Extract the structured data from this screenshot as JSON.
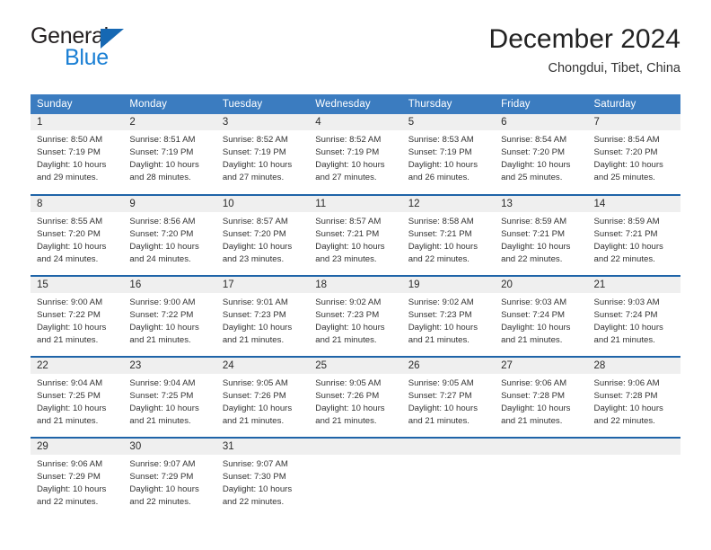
{
  "brand": {
    "name_part1": "General",
    "name_part2": "Blue",
    "triangle_icon": "triangle-icon",
    "accent_dark": "#231f20",
    "accent_blue": "#1a7fd4"
  },
  "header": {
    "title": "December 2024",
    "subtitle": "Chongdui, Tibet, China"
  },
  "theme": {
    "header_bg": "#3b7cc0",
    "row_divider": "#1f64a8",
    "daynum_bg": "#efefef"
  },
  "weekday_headers": [
    "Sunday",
    "Monday",
    "Tuesday",
    "Wednesday",
    "Thursday",
    "Friday",
    "Saturday"
  ],
  "labels": {
    "sunrise_prefix": "Sunrise:",
    "sunset_prefix": "Sunset:",
    "daylight_prefix": "Daylight:"
  },
  "weeks": [
    {
      "days": [
        {
          "num": "1",
          "sunrise": "Sunrise: 8:50 AM",
          "sunset": "Sunset: 7:19 PM",
          "daylight_l1": "Daylight: 10 hours",
          "daylight_l2": "and 29 minutes."
        },
        {
          "num": "2",
          "sunrise": "Sunrise: 8:51 AM",
          "sunset": "Sunset: 7:19 PM",
          "daylight_l1": "Daylight: 10 hours",
          "daylight_l2": "and 28 minutes."
        },
        {
          "num": "3",
          "sunrise": "Sunrise: 8:52 AM",
          "sunset": "Sunset: 7:19 PM",
          "daylight_l1": "Daylight: 10 hours",
          "daylight_l2": "and 27 minutes."
        },
        {
          "num": "4",
          "sunrise": "Sunrise: 8:52 AM",
          "sunset": "Sunset: 7:19 PM",
          "daylight_l1": "Daylight: 10 hours",
          "daylight_l2": "and 27 minutes."
        },
        {
          "num": "5",
          "sunrise": "Sunrise: 8:53 AM",
          "sunset": "Sunset: 7:19 PM",
          "daylight_l1": "Daylight: 10 hours",
          "daylight_l2": "and 26 minutes."
        },
        {
          "num": "6",
          "sunrise": "Sunrise: 8:54 AM",
          "sunset": "Sunset: 7:20 PM",
          "daylight_l1": "Daylight: 10 hours",
          "daylight_l2": "and 25 minutes."
        },
        {
          "num": "7",
          "sunrise": "Sunrise: 8:54 AM",
          "sunset": "Sunset: 7:20 PM",
          "daylight_l1": "Daylight: 10 hours",
          "daylight_l2": "and 25 minutes."
        }
      ]
    },
    {
      "days": [
        {
          "num": "8",
          "sunrise": "Sunrise: 8:55 AM",
          "sunset": "Sunset: 7:20 PM",
          "daylight_l1": "Daylight: 10 hours",
          "daylight_l2": "and 24 minutes."
        },
        {
          "num": "9",
          "sunrise": "Sunrise: 8:56 AM",
          "sunset": "Sunset: 7:20 PM",
          "daylight_l1": "Daylight: 10 hours",
          "daylight_l2": "and 24 minutes."
        },
        {
          "num": "10",
          "sunrise": "Sunrise: 8:57 AM",
          "sunset": "Sunset: 7:20 PM",
          "daylight_l1": "Daylight: 10 hours",
          "daylight_l2": "and 23 minutes."
        },
        {
          "num": "11",
          "sunrise": "Sunrise: 8:57 AM",
          "sunset": "Sunset: 7:21 PM",
          "daylight_l1": "Daylight: 10 hours",
          "daylight_l2": "and 23 minutes."
        },
        {
          "num": "12",
          "sunrise": "Sunrise: 8:58 AM",
          "sunset": "Sunset: 7:21 PM",
          "daylight_l1": "Daylight: 10 hours",
          "daylight_l2": "and 22 minutes."
        },
        {
          "num": "13",
          "sunrise": "Sunrise: 8:59 AM",
          "sunset": "Sunset: 7:21 PM",
          "daylight_l1": "Daylight: 10 hours",
          "daylight_l2": "and 22 minutes."
        },
        {
          "num": "14",
          "sunrise": "Sunrise: 8:59 AM",
          "sunset": "Sunset: 7:21 PM",
          "daylight_l1": "Daylight: 10 hours",
          "daylight_l2": "and 22 minutes."
        }
      ]
    },
    {
      "days": [
        {
          "num": "15",
          "sunrise": "Sunrise: 9:00 AM",
          "sunset": "Sunset: 7:22 PM",
          "daylight_l1": "Daylight: 10 hours",
          "daylight_l2": "and 21 minutes."
        },
        {
          "num": "16",
          "sunrise": "Sunrise: 9:00 AM",
          "sunset": "Sunset: 7:22 PM",
          "daylight_l1": "Daylight: 10 hours",
          "daylight_l2": "and 21 minutes."
        },
        {
          "num": "17",
          "sunrise": "Sunrise: 9:01 AM",
          "sunset": "Sunset: 7:23 PM",
          "daylight_l1": "Daylight: 10 hours",
          "daylight_l2": "and 21 minutes."
        },
        {
          "num": "18",
          "sunrise": "Sunrise: 9:02 AM",
          "sunset": "Sunset: 7:23 PM",
          "daylight_l1": "Daylight: 10 hours",
          "daylight_l2": "and 21 minutes."
        },
        {
          "num": "19",
          "sunrise": "Sunrise: 9:02 AM",
          "sunset": "Sunset: 7:23 PM",
          "daylight_l1": "Daylight: 10 hours",
          "daylight_l2": "and 21 minutes."
        },
        {
          "num": "20",
          "sunrise": "Sunrise: 9:03 AM",
          "sunset": "Sunset: 7:24 PM",
          "daylight_l1": "Daylight: 10 hours",
          "daylight_l2": "and 21 minutes."
        },
        {
          "num": "21",
          "sunrise": "Sunrise: 9:03 AM",
          "sunset": "Sunset: 7:24 PM",
          "daylight_l1": "Daylight: 10 hours",
          "daylight_l2": "and 21 minutes."
        }
      ]
    },
    {
      "days": [
        {
          "num": "22",
          "sunrise": "Sunrise: 9:04 AM",
          "sunset": "Sunset: 7:25 PM",
          "daylight_l1": "Daylight: 10 hours",
          "daylight_l2": "and 21 minutes."
        },
        {
          "num": "23",
          "sunrise": "Sunrise: 9:04 AM",
          "sunset": "Sunset: 7:25 PM",
          "daylight_l1": "Daylight: 10 hours",
          "daylight_l2": "and 21 minutes."
        },
        {
          "num": "24",
          "sunrise": "Sunrise: 9:05 AM",
          "sunset": "Sunset: 7:26 PM",
          "daylight_l1": "Daylight: 10 hours",
          "daylight_l2": "and 21 minutes."
        },
        {
          "num": "25",
          "sunrise": "Sunrise: 9:05 AM",
          "sunset": "Sunset: 7:26 PM",
          "daylight_l1": "Daylight: 10 hours",
          "daylight_l2": "and 21 minutes."
        },
        {
          "num": "26",
          "sunrise": "Sunrise: 9:05 AM",
          "sunset": "Sunset: 7:27 PM",
          "daylight_l1": "Daylight: 10 hours",
          "daylight_l2": "and 21 minutes."
        },
        {
          "num": "27",
          "sunrise": "Sunrise: 9:06 AM",
          "sunset": "Sunset: 7:28 PM",
          "daylight_l1": "Daylight: 10 hours",
          "daylight_l2": "and 21 minutes."
        },
        {
          "num": "28",
          "sunrise": "Sunrise: 9:06 AM",
          "sunset": "Sunset: 7:28 PM",
          "daylight_l1": "Daylight: 10 hours",
          "daylight_l2": "and 22 minutes."
        }
      ]
    },
    {
      "days": [
        {
          "num": "29",
          "sunrise": "Sunrise: 9:06 AM",
          "sunset": "Sunset: 7:29 PM",
          "daylight_l1": "Daylight: 10 hours",
          "daylight_l2": "and 22 minutes."
        },
        {
          "num": "30",
          "sunrise": "Sunrise: 9:07 AM",
          "sunset": "Sunset: 7:29 PM",
          "daylight_l1": "Daylight: 10 hours",
          "daylight_l2": "and 22 minutes."
        },
        {
          "num": "31",
          "sunrise": "Sunrise: 9:07 AM",
          "sunset": "Sunset: 7:30 PM",
          "daylight_l1": "Daylight: 10 hours",
          "daylight_l2": "and 22 minutes."
        },
        {
          "num": "",
          "sunrise": "",
          "sunset": "",
          "daylight_l1": "",
          "daylight_l2": ""
        },
        {
          "num": "",
          "sunrise": "",
          "sunset": "",
          "daylight_l1": "",
          "daylight_l2": ""
        },
        {
          "num": "",
          "sunrise": "",
          "sunset": "",
          "daylight_l1": "",
          "daylight_l2": ""
        },
        {
          "num": "",
          "sunrise": "",
          "sunset": "",
          "daylight_l1": "",
          "daylight_l2": ""
        }
      ]
    }
  ]
}
